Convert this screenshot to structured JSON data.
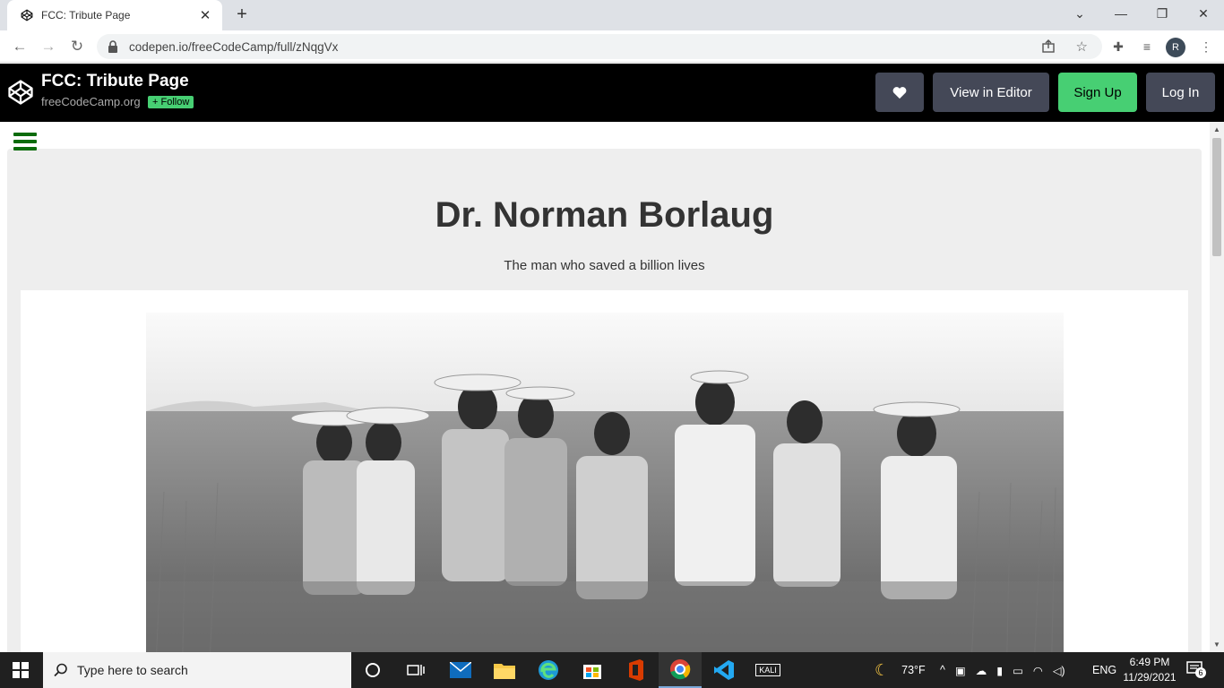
{
  "browser": {
    "tab_title": "FCC: Tribute Page",
    "url": "codepen.io/freeCodeCamp/full/zNqgVx",
    "profile_initial": "R"
  },
  "codepen": {
    "title": "FCC: Tribute Page",
    "owner": "freeCodeCamp.org",
    "follow_label": "+ Follow",
    "view_in_editor": "View in Editor",
    "sign_up": "Sign Up",
    "log_in": "Log In",
    "colors": {
      "header_bg": "#000000",
      "button_gray": "#444857",
      "signup_green": "#47cf73"
    }
  },
  "tribute": {
    "title": "Dr. Norman Borlaug",
    "subtitle": "The man who saved a billion lives",
    "image_icon": "photo-men-in-wheat-field"
  },
  "taskbar": {
    "search_placeholder": "Type here to search",
    "weather": "73°F",
    "language": "ENG",
    "time": "6:49 PM",
    "date": "11/29/2021",
    "notification_count": "6",
    "kali_label": "KALI"
  }
}
